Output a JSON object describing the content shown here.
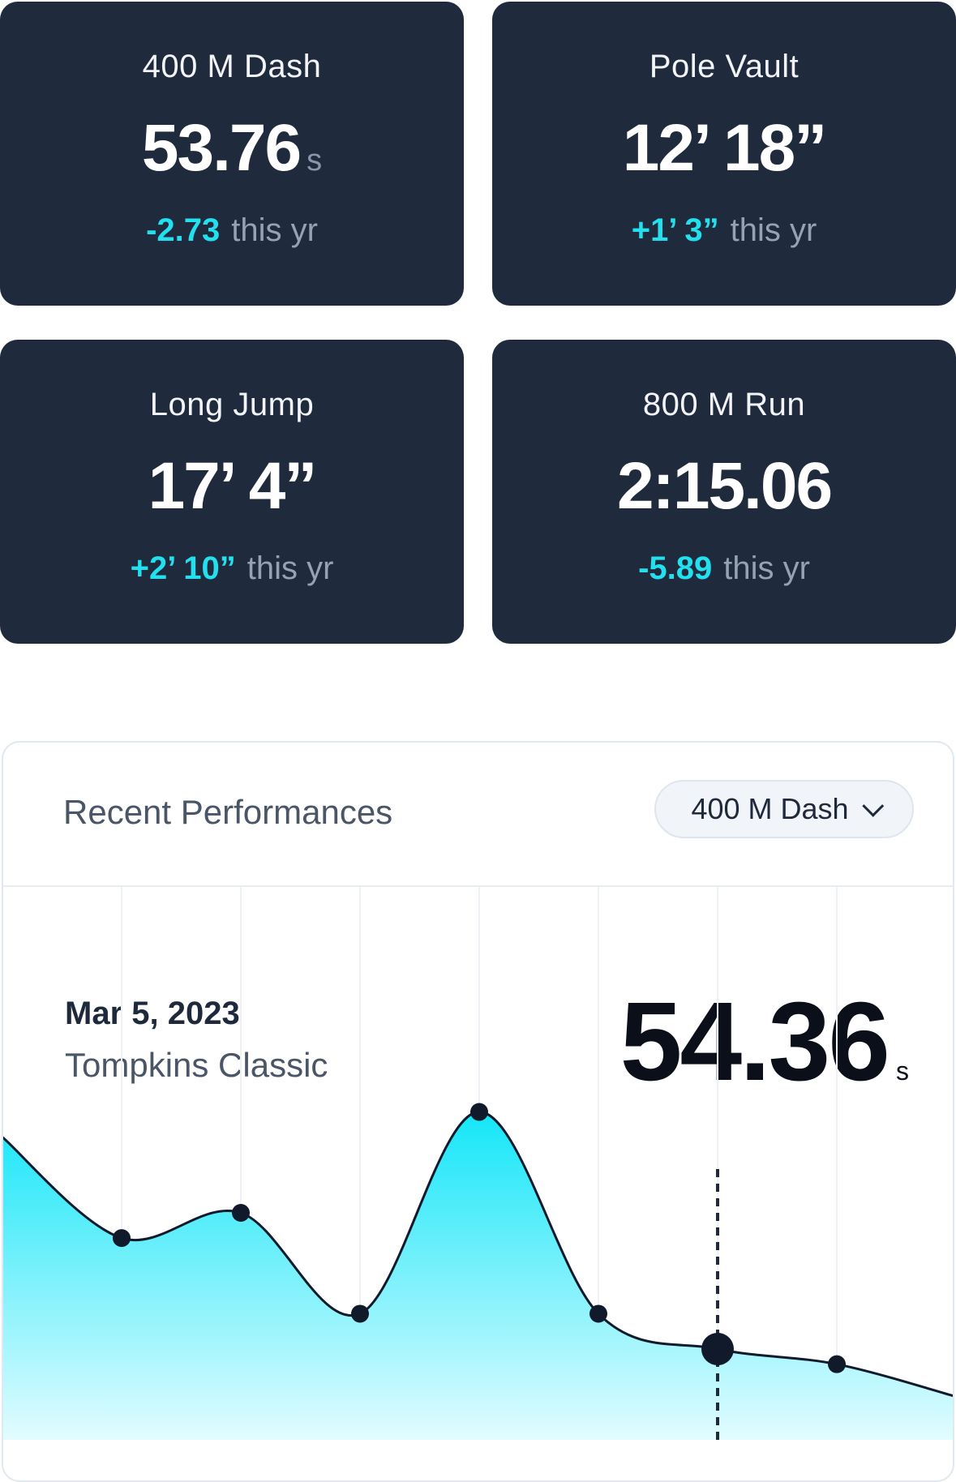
{
  "cards": [
    {
      "title": "400 M Dash",
      "value": "53.76",
      "unit": "s",
      "change": "-2.73",
      "suffix": "this yr"
    },
    {
      "title": "Pole Vault",
      "value": "12’ 18”",
      "unit": "",
      "change": "+1’ 3”",
      "suffix": "this yr"
    },
    {
      "title": "Long Jump",
      "value": "17’ 4”",
      "unit": "",
      "change": "+2’ 10”",
      "suffix": "this yr"
    },
    {
      "title": "800 M Run",
      "value": "2:15.06",
      "unit": "",
      "change": "-5.89",
      "suffix": "this yr"
    }
  ],
  "panel": {
    "title": "Recent Performances",
    "select": {
      "value": "400 M Dash",
      "icon": "chevron-down-icon"
    },
    "selected": {
      "date": "Mar 5, 2023",
      "meet": "Tompkins Classic",
      "value": "54.36",
      "unit": "s"
    }
  },
  "colors": {
    "card_bg": "#1f2a3c",
    "accent": "#23e0ef",
    "muted": "#95a2b3"
  },
  "chart_data": {
    "type": "area",
    "values": [
      55.2,
      54.8,
      54.9,
      54.5,
      55.3,
      54.5,
      54.36,
      54.3
    ],
    "selected_index": 6,
    "title": "",
    "xlabel": "",
    "ylabel": ""
  }
}
